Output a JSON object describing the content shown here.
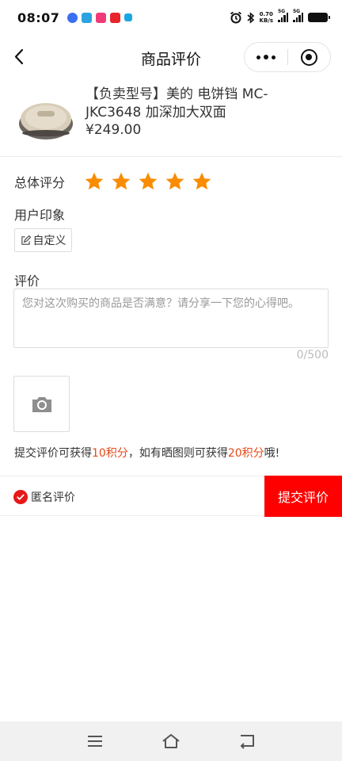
{
  "status_bar": {
    "time": "08:07",
    "net_speed_value": "0.70",
    "net_speed_unit": "KB/s",
    "signal_1": "5G",
    "signal_2": "5G"
  },
  "nav": {
    "title": "商品评价"
  },
  "product": {
    "title": "【负卖型号】美的 电饼铛 MC-JKC3648 加深加大双面",
    "price": "¥249.00"
  },
  "rating": {
    "label": "总体评分",
    "stars": 5,
    "max_stars": 5,
    "star_color": "#fa8c00"
  },
  "impression": {
    "label": "用户印象",
    "custom_tag": "自定义"
  },
  "review": {
    "label": "评价",
    "placeholder": "您对这次购买的商品是否满意？请分享一下您的心得吧。",
    "counter": "0/500"
  },
  "points": {
    "part1": "提交评价可获得",
    "points1": "10积分",
    "part2": "，如有晒图则可获得",
    "points2": "20积分",
    "part3": "哦!"
  },
  "bottom": {
    "anonymous_label": "匿名评价",
    "submit_label": "提交评价",
    "accent_color": "#fe0000"
  },
  "icons": {
    "back": "chevron-left-icon",
    "more": "more-dots-icon",
    "close": "target-close-icon",
    "camera": "camera-icon",
    "edit": "pen-icon",
    "check": "check-circle-icon",
    "sys_menu": "menu-icon",
    "sys_home": "home-icon",
    "sys_back": "back-icon"
  }
}
